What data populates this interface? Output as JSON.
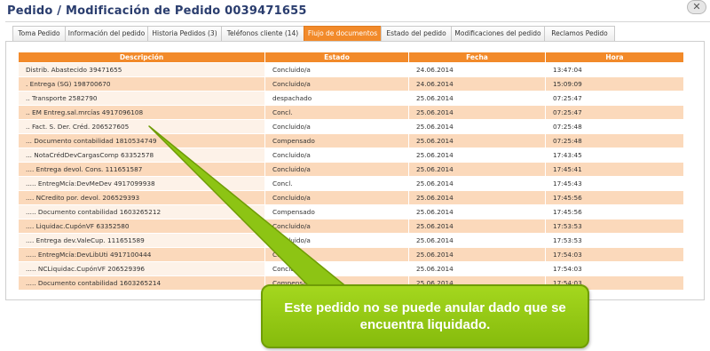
{
  "header": {
    "title": "Pedido / Modificación de Pedido 0039471655",
    "close_icon": "close-icon"
  },
  "tabs": [
    {
      "label": "Toma Pedido",
      "active": false
    },
    {
      "label": "Información del pedido",
      "active": false
    },
    {
      "label": "Historia Pedidos (3)",
      "active": false
    },
    {
      "label": "Teléfonos cliente (14)",
      "active": false
    },
    {
      "label": "Flujo de documentos",
      "active": true
    },
    {
      "label": "Estado del pedido",
      "active": false
    },
    {
      "label": "Modificaciones del pedido",
      "active": false
    },
    {
      "label": "Reclamos Pedido",
      "active": false
    }
  ],
  "table": {
    "columns": [
      "Descripción",
      "Estado",
      "Fecha",
      "Hora"
    ],
    "rows": [
      [
        "Distrib. Abastecido 39471655",
        "Concluido/a",
        "24.06.2014",
        "13:47:04"
      ],
      [
        ". Entrega (SG) 198700670",
        "Concluido/a",
        "24.06.2014",
        "15:09:09"
      ],
      [
        ".. Transporte 2582790",
        "despachado",
        "25.06.2014",
        "07:25:47"
      ],
      [
        ".. EM Entreg.sal.mrcías 4917096108",
        "Concl.",
        "25.06.2014",
        "07:25:47"
      ],
      [
        ".. Fact. S. Der. Créd. 206527605",
        "Concluido/a",
        "25.06.2014",
        "07:25:48"
      ],
      [
        "... Documento contabilidad 1810534749",
        "Compensado",
        "25.06.2014",
        "07:25:48"
      ],
      [
        "... NotaCrédDevCargasComp 63352578",
        "Concluido/a",
        "25.06.2014",
        "17:43:45"
      ],
      [
        ".... Entrega devol. Cons. 111651587",
        "Concluido/a",
        "25.06.2014",
        "17:45:41"
      ],
      [
        "..... EntregMcía:DevMeDev 4917099938",
        "Concl.",
        "25.06.2014",
        "17:45:43"
      ],
      [
        ".... NCredito por. devol. 206529393",
        "Concluido/a",
        "25.06.2014",
        "17:45:56"
      ],
      [
        "..... Documento contabilidad 1603265212",
        "Compensado",
        "25.06.2014",
        "17:45:56"
      ],
      [
        ".... Liquidac.CupónVF 63352580",
        "Concluido/a",
        "25.06.2014",
        "17:53:53"
      ],
      [
        ".... Entrega dev.ValeCup. 111651589",
        "Concluido/a",
        "25.06.2014",
        "17:53:53"
      ],
      [
        "..... EntregMcía:DevLibUti 4917100444",
        "Concl.",
        "25.06.2014",
        "17:54:03"
      ],
      [
        "..... NCLiquidac.CupónVF 206529396",
        "Concluido/a",
        "25.06.2014",
        "17:54:03"
      ],
      [
        "..... Documento contabilidad 1603265214",
        "Compensado",
        "25.06.2014",
        "17:54:03"
      ]
    ]
  },
  "callout": {
    "text": "Este pedido no se puede anular dado que se encuentra liquidado."
  },
  "colors": {
    "accent_orange": "#f28a2a",
    "row_stripe": "#fbd9bb",
    "callout_green": "#8dc414",
    "title_navy": "#2a3d6e"
  }
}
